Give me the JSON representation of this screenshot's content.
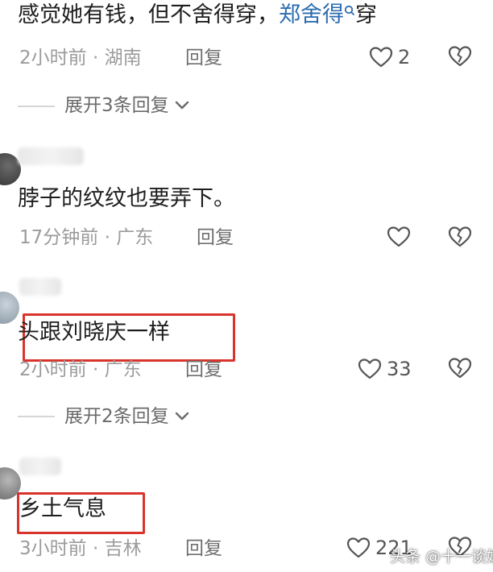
{
  "comments": [
    {
      "text_before": "感觉她有钱，但不舍得穿，",
      "link_text": "郑舍得",
      "text_after": "穿",
      "time": "2小时前",
      "location": "湖南",
      "reply_label": "回复",
      "likes": "2",
      "expand_label": "展开3条回复"
    },
    {
      "text": "脖子的纹纹也要弄下。",
      "time": "17分钟前",
      "location": "广东",
      "reply_label": "回复"
    },
    {
      "text": "头跟刘晓庆一样",
      "time": "2小时前",
      "location": "广东",
      "reply_label": "回复",
      "likes": "33",
      "expand_label": "展开2条回复"
    },
    {
      "text": "乡土气息",
      "time": "3小时前",
      "location": "吉林",
      "reply_label": "回复",
      "likes": "221"
    }
  ],
  "separator": "·",
  "watermark": "头条 @十一谈娱",
  "colors": {
    "highlight": "#d9342b",
    "link": "#2b6cb0"
  }
}
